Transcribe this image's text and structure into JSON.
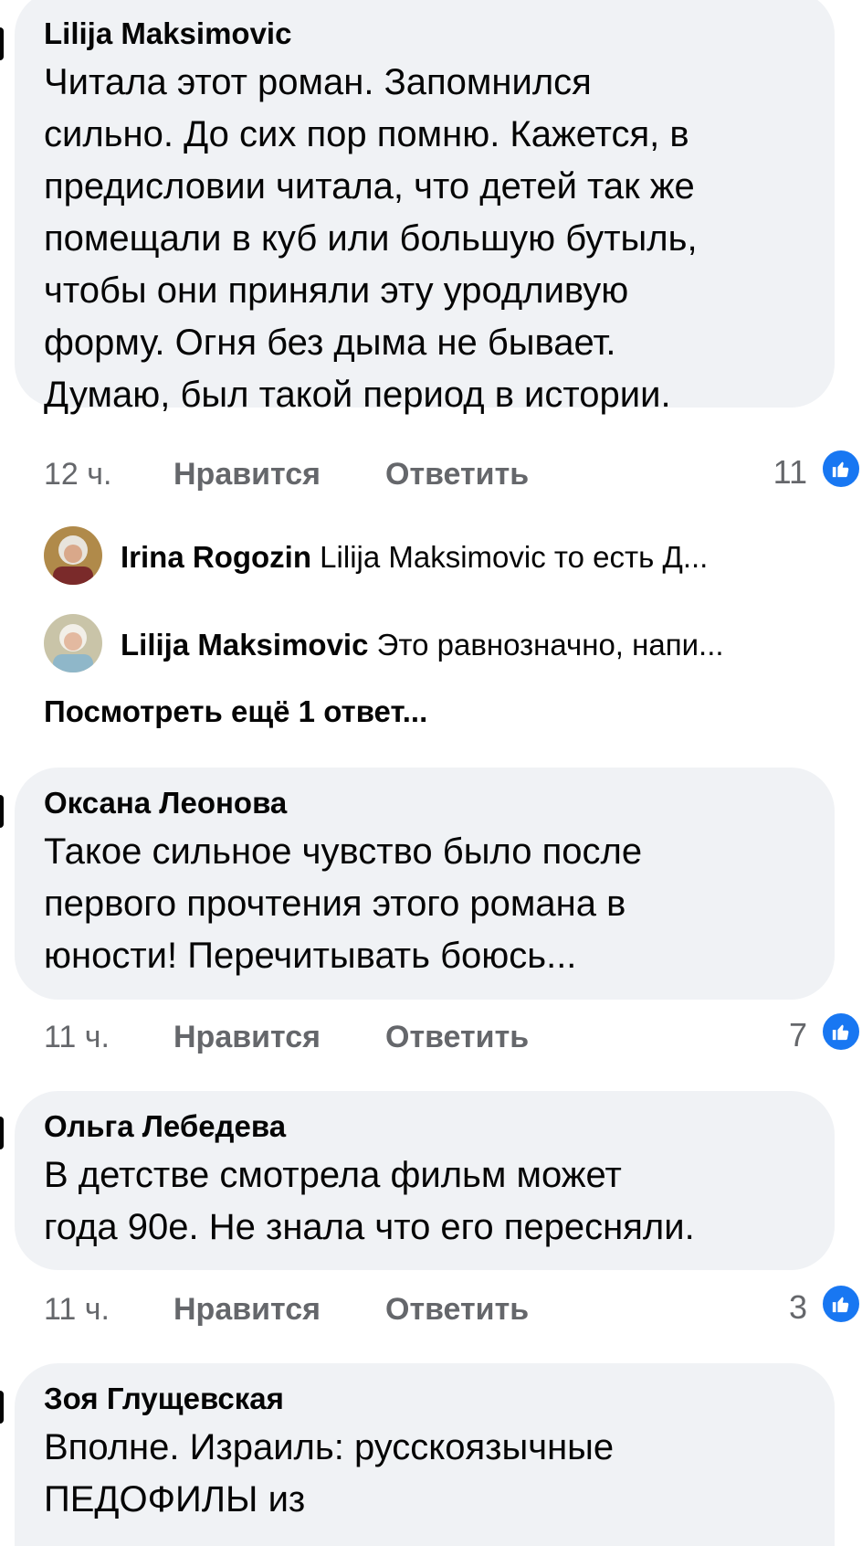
{
  "comments": [
    {
      "author": "Lilija Maksimovic",
      "lines": [
        "Читала этот роман. Запомнился",
        "сильно. До сих пор помню. Кажется, в",
        "предисловии читала, что детей так же",
        "помещали в куб или большую бутыль,",
        "чтобы они приняли эту уродливую",
        "форму.  Огня без дыма не бывает.",
        "Думаю, был такой период в истории."
      ],
      "time": "12 ч.",
      "like_label": "Нравится",
      "reply_label": "Ответить",
      "reactions": "11"
    },
    {
      "author": "Оксана Леонова",
      "lines": [
        "Такое сильное чувство было после",
        "первого прочтения этого романа в",
        "юности! Перечитывать боюсь..."
      ],
      "time": "11 ч.",
      "like_label": "Нравится",
      "reply_label": "Ответить",
      "reactions": "7"
    },
    {
      "author": "Ольга Лебедева",
      "lines": [
        "В детстве смотрела фильм может",
        "года 90е. Не знала что его пересняли."
      ],
      "time": "11 ч.",
      "like_label": "Нравится",
      "reply_label": "Ответить",
      "reactions": "3"
    },
    {
      "author": "Зоя Глущевская",
      "lines": [
        "Вполне. Израиль: русскоязычные",
        "ПЕДОФИЛЫ из"
      ]
    }
  ],
  "replies": [
    {
      "author": "Irina Rogozin",
      "text": "Lilija Maksimovic  то есть Д..."
    },
    {
      "author": "Lilija Maksimovic",
      "text": "Это равнозначно, напи..."
    }
  ],
  "view_more": "Посмотреть ещё 1 ответ...",
  "colors": {
    "bubble": "#f0f2f5",
    "meta": "#65676b",
    "like_blue": "#1877f2"
  }
}
